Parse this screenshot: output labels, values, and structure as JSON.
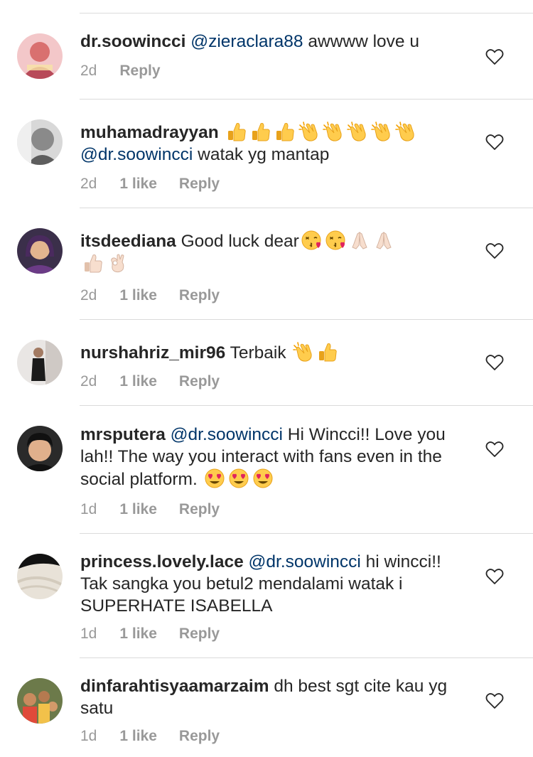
{
  "comments": [
    {
      "username": "dr.soowincci",
      "mention": "@zieraclara88",
      "text": " awwww love u",
      "time": "2d",
      "likes": "",
      "reply": "Reply"
    },
    {
      "username": "muhamadrayyan",
      "emoji_line_1": [
        "thumbs-up",
        "thumbs-up",
        "thumbs-up",
        "clapping-hands",
        "clapping-hands",
        "clapping-hands",
        "clapping-hands",
        "clapping-hands"
      ],
      "mention": "@dr.soowincci",
      "text": " watak yg mantap",
      "time": "2d",
      "likes": "1 like",
      "reply": "Reply"
    },
    {
      "username": "itsdeediana",
      "text": " Good luck dear",
      "emoji_line_1": [
        "face-blowing-kiss",
        "face-blowing-kiss",
        "folded-hands",
        "folded-hands"
      ],
      "emoji_line_2": [
        "thumbs-up",
        "ok-hand"
      ],
      "time": "2d",
      "likes": "1 like",
      "reply": "Reply"
    },
    {
      "username": "nurshahriz_mir96",
      "text": " Terbaik ",
      "emoji_line_1": [
        "clapping-hands",
        "thumbs-up"
      ],
      "time": "2d",
      "likes": "1 like",
      "reply": "Reply"
    },
    {
      "username": "mrsputera",
      "mention": "@dr.soowincci",
      "text": " Hi Wincci!! Love you lah!! The way you interact with fans even in the social platform. ",
      "emoji_line_1": [
        "heart-eyes",
        "heart-eyes",
        "heart-eyes"
      ],
      "time": "1d",
      "likes": "1 like",
      "reply": "Reply"
    },
    {
      "username": "princess.lovely.lace",
      "mention": "@dr.soowincci",
      "text": " hi wincci!! Tak sangka you betul2 mendalami watak i SUPERHATE ISABELLA",
      "time": "1d",
      "likes": "1 like",
      "reply": "Reply"
    },
    {
      "username": "dinfarahtisyaamarzaim",
      "text": " dh best sgt cite kau yg satu",
      "time": "1d",
      "likes": "1 like",
      "reply": "Reply"
    }
  ],
  "icons": {
    "like": "heart-outline-icon"
  },
  "colors": {
    "text": "#262626",
    "mention": "#003569",
    "meta": "#999999",
    "divider": "#dbdbdb"
  }
}
